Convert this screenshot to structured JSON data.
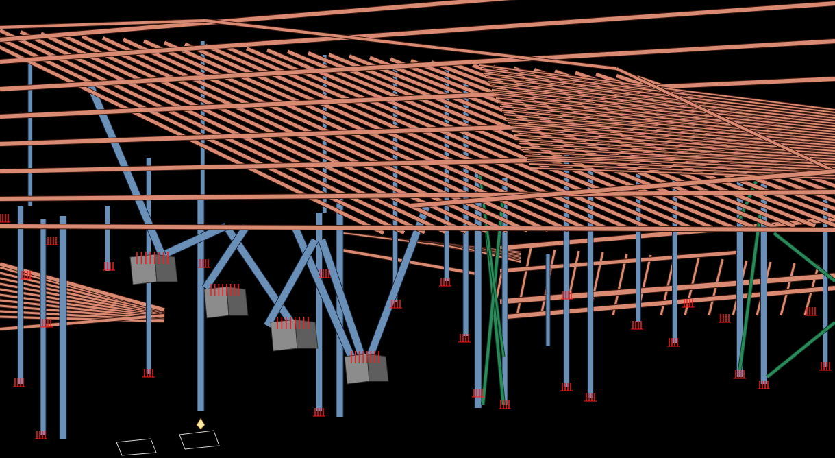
{
  "viewport": {
    "background": "#000000"
  },
  "colors": {
    "beam_fill": "#d98a72",
    "beam_edge": "#3a1a12",
    "beam_dark": "#8a4a3a",
    "column_fill": "#6b90b8",
    "column_edge": "#1c2c44",
    "brace_green": "#2a8a5a",
    "footing_fill": "#8c8c8c",
    "footing_dark": "#5e5e5e",
    "anchor_red": "#ff1a1a",
    "grid_white": "#d8d8d8",
    "cursor": "#ffe8a0"
  },
  "icons": {
    "view_cursor": "cursor-arrow-icon"
  }
}
